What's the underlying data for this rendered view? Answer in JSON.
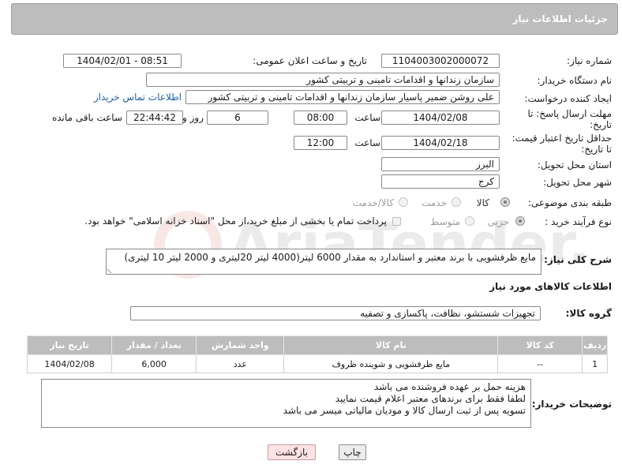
{
  "header": {
    "title": "جزئیات اطلاعات نیاز"
  },
  "form": {
    "need_number": {
      "label": "شماره نیاز:",
      "value": "1104003002000072"
    },
    "announce_datetime": {
      "label": "تاریخ و ساعت اعلان عمومی:",
      "value": "1404/02/01 - 08:51"
    },
    "buyer_org": {
      "label": "نام دستگاه خریدار:",
      "value": "سازمان زندانها و اقدامات تامینی و تربیتی کشور"
    },
    "creator": {
      "label": "ایجاد کننده درخواست:",
      "value": "علی روشن ضمیر پاسیار سازمان زندانها و اقدامات تامینی و تربیتی کشور",
      "contact_link": "اطلاعات تماس خریدار"
    },
    "reply_deadline": {
      "label_line1": "مهلت ارسال پاسخ: تا",
      "label_line2": "تاریخ:",
      "date": "1404/02/08",
      "time_label": "ساعت",
      "time": "08:00",
      "days": "6",
      "days_label": "روز و",
      "remaining": "22:44:42",
      "remaining_label": "ساعت باقی مانده"
    },
    "price_validity": {
      "label_line1": "حداقل تاریخ اعتبار قیمت:",
      "label_line2": "تا تاریخ:",
      "date": "1404/02/18",
      "time_label": "ساعت",
      "time": "12:00"
    },
    "delivery_province": {
      "label": "استان محل تحویل:",
      "value": "البرز"
    },
    "delivery_city": {
      "label": "شهر محل تحویل:",
      "value": "کرج"
    },
    "category": {
      "label": "طبقه بندی موضوعی:",
      "options": [
        "کالا",
        "خدمت",
        "کالا/خدمت"
      ],
      "selected": "کالا"
    },
    "purchase_type": {
      "label": "نوع فرآیند خرید :",
      "options": [
        "جزیی",
        "متوسط"
      ],
      "selected": "جزیی",
      "payment_note": "پرداخت تمام یا بخشی از مبلغ خرید،از محل \"اسناد خزانه اسلامی\" خواهد بود."
    }
  },
  "description": {
    "label": "شرح کلی نیاز:",
    "value": "مایع ظرفشویی با برند معتبر و استاندارد به مقدار 6000 لیتر(4000 لیتر 20لیتری و 2000 لیتر 10 لیتری)"
  },
  "goods_section": {
    "title": "اطلاعات کالاهای مورد نیاز",
    "group_label": "گروه کالا:",
    "group_value": "تجهیزات شستشو، نظافت، پاکسازی و تصفیه"
  },
  "table": {
    "headers": [
      "ردیف",
      "کد کالا",
      "نام کالا",
      "واحد شمارش",
      "تعداد / مقدار",
      "تاریخ نیاز"
    ],
    "rows": [
      [
        "1",
        "--",
        "مایع ظرفشویی و شوینده ظروف",
        "عدد",
        "6,000",
        "1404/02/08"
      ]
    ]
  },
  "buyer_notes": {
    "label": "توضیحات خریدار:",
    "lines": [
      "هزینه حمل بر عهده فروشنده می باشد",
      "لطفا فقط برای برندهای معتبر اعلام قیمت نمایید",
      "تسویه پس از ثبت ارسال کالا و مودیان مالیاتی میسر می باشد"
    ]
  },
  "buttons": {
    "print": "چاپ",
    "back": "بازگشت"
  },
  "watermark": {
    "text": "AriaTender.net"
  }
}
